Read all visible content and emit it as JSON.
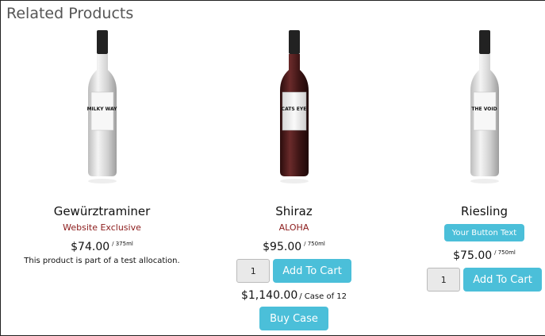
{
  "section": {
    "title": "Related Products"
  },
  "products": [
    {
      "name": "Gewürztraminer",
      "subtitle": "Website Exclusive",
      "price": "$74.00",
      "unit": "/ 375ml",
      "note": "This product is part of a test allocation.",
      "bottle": {
        "glass_color": "#dcdcdc",
        "label_text": "MILKY WAY"
      }
    },
    {
      "name": "Shiraz",
      "subtitle": "ALOHA",
      "price": "$95.00",
      "unit": "/ 750ml",
      "qty": "1",
      "add_to_cart": "Add To Cart",
      "case_price": "$1,140.00",
      "case_suffix": "/ Case of 12",
      "buy_case": "Buy Case",
      "bottle": {
        "glass_color": "#4a1c1c",
        "label_text": "CATS EYE"
      }
    },
    {
      "name": "Riesling",
      "custom_button": "Your Button Text",
      "price": "$75.00",
      "unit": "/ 750ml",
      "qty": "1",
      "add_to_cart": "Add To Cart",
      "bottle": {
        "glass_color": "#dcdcdc",
        "label_text": "THE VOID"
      }
    }
  ],
  "colors": {
    "accent": "#4bbfd9",
    "subtitle": "#8b1a1a"
  }
}
